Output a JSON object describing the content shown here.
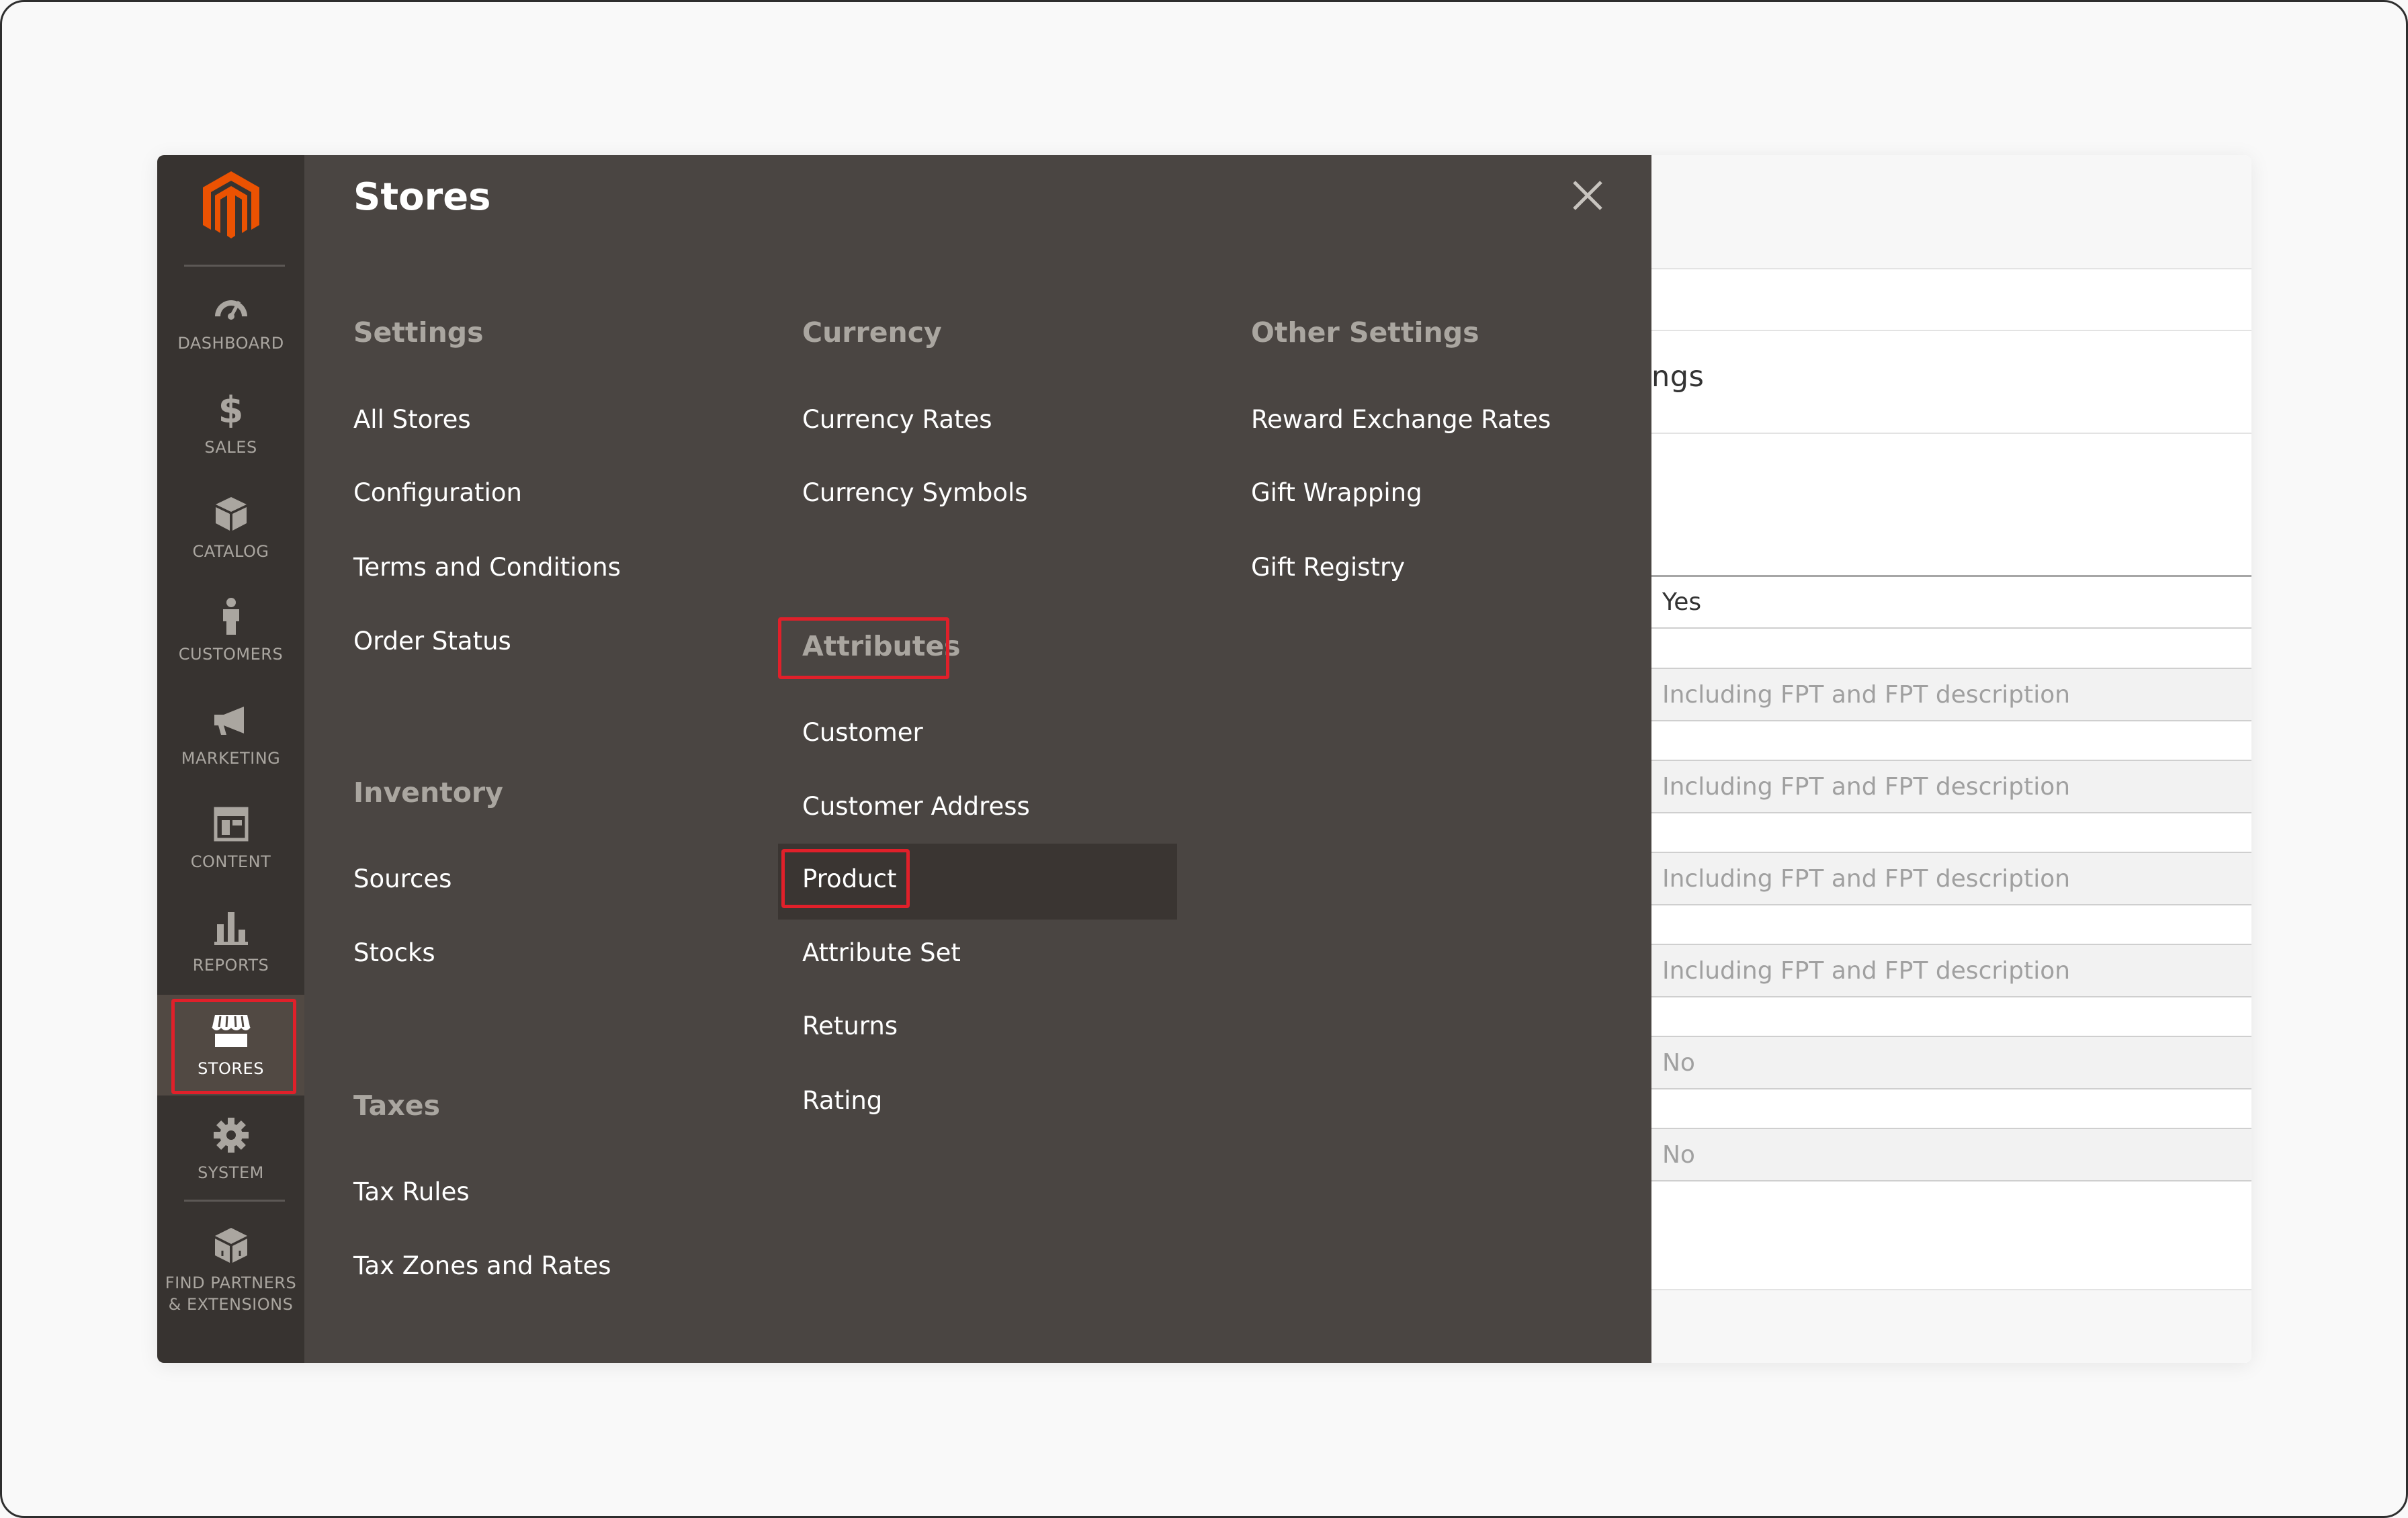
{
  "sidebar": {
    "logo": "magento-logo",
    "items": [
      {
        "label": "DASHBOARD",
        "icon": "dashboard-gauge-icon"
      },
      {
        "label": "SALES",
        "icon": "dollar-icon"
      },
      {
        "label": "CATALOG",
        "icon": "box-icon"
      },
      {
        "label": "CUSTOMERS",
        "icon": "person-icon"
      },
      {
        "label": "MARKETING",
        "icon": "megaphone-icon"
      },
      {
        "label": "CONTENT",
        "icon": "layout-icon"
      },
      {
        "label": "REPORTS",
        "icon": "bar-chart-icon"
      },
      {
        "label": "STORES",
        "icon": "storefront-icon"
      },
      {
        "label": "SYSTEM",
        "icon": "gear-icon"
      },
      {
        "label_line1": "FIND PARTNERS",
        "label_line2": "& EXTENSIONS",
        "icon": "cubes-icon"
      }
    ],
    "active": "STORES"
  },
  "panel": {
    "title": "Stores",
    "close_icon": "close-icon",
    "columns": [
      {
        "sections": [
          {
            "title": "Settings",
            "links": [
              "All Stores",
              "Configuration",
              "Terms and Conditions",
              "Order Status"
            ]
          },
          {
            "title": "Inventory",
            "links": [
              "Sources",
              "Stocks"
            ]
          },
          {
            "title": "Taxes",
            "links": [
              "Tax Rules",
              "Tax Zones and Rates"
            ]
          }
        ]
      },
      {
        "sections": [
          {
            "title": "Currency",
            "links": [
              "Currency Rates",
              "Currency Symbols"
            ]
          },
          {
            "title": "Attributes",
            "links": [
              "Customer",
              "Customer Address",
              "Product",
              "Attribute Set",
              "Returns",
              "Rating"
            ]
          }
        ]
      },
      {
        "sections": [
          {
            "title": "Other Settings",
            "links": [
              "Reward Exchange Rates",
              "Gift Wrapping",
              "Gift Registry"
            ]
          }
        ]
      }
    ]
  },
  "background": {
    "title_fragment": "ngs",
    "fields": [
      {
        "value": "Yes",
        "state": "active"
      },
      {
        "value": "Including FPT and FPT description",
        "state": "disabled"
      },
      {
        "value": "Including FPT and FPT description",
        "state": "disabled"
      },
      {
        "value": "Including FPT and FPT description",
        "state": "disabled"
      },
      {
        "value": "Including FPT and FPT description",
        "state": "disabled"
      },
      {
        "value": "No",
        "state": "disabled"
      },
      {
        "value": "No",
        "state": "disabled"
      }
    ]
  },
  "colors": {
    "sidebar_bg": "#373330",
    "panel_bg": "#4a4542",
    "accent_orange": "#eb5202",
    "highlight_red": "#e0202a"
  }
}
